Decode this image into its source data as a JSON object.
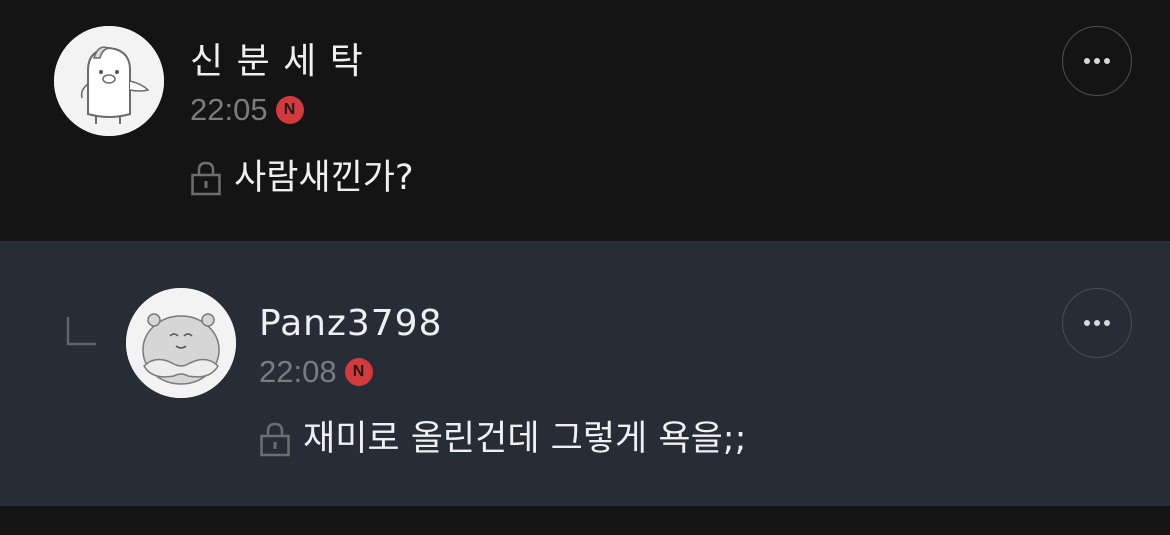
{
  "comments": [
    {
      "author": "신 분 세 탁",
      "time": "22:05",
      "badge": "N",
      "text": "사람새낀가?",
      "avatar_icon": "penguin-avatar-icon"
    },
    {
      "author": "Panz3798",
      "time": "22:08",
      "badge": "N",
      "text": "재미로 올린건데 그렇게 욕을;;",
      "avatar_icon": "hamster-avatar-icon",
      "is_reply": true
    }
  ],
  "colors": {
    "background": "#141414",
    "reply_background": "#262d37",
    "badge": "#d23a3e",
    "text": "#f0f0f0",
    "meta": "#7c7c7c"
  },
  "icons": {
    "more": "more-options-icon",
    "lock": "lock-icon",
    "reply": "reply-arrow-icon"
  }
}
